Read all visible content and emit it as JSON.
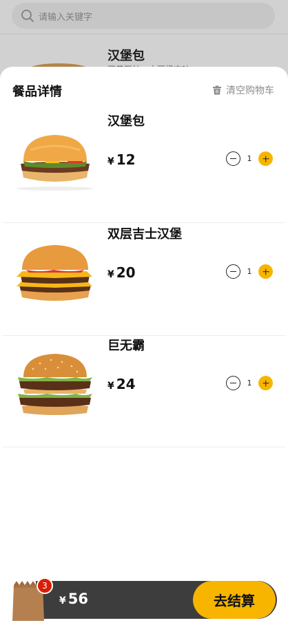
{
  "search": {
    "placeholder": "请输入关键字"
  },
  "background_item": {
    "title": "汉堡包",
    "description": "不曾瓦杜，土豆橙杏吐…"
  },
  "sheet": {
    "title": "餐品详情",
    "clear_cart_label": "清空购物车",
    "currency_symbol": "¥",
    "items": [
      {
        "name": "汉堡包",
        "price": "12",
        "quantity": "1"
      },
      {
        "name": "双层吉士汉堡",
        "price": "20",
        "quantity": "1"
      },
      {
        "name": "巨无霸",
        "price": "24",
        "quantity": "1"
      }
    ]
  },
  "cart": {
    "badge_count": "3",
    "currency_symbol": "¥",
    "total": "56",
    "checkout_label": "去结算"
  },
  "colors": {
    "accent": "#f7b500",
    "bar": "#3d3d3d",
    "badge": "#d81e06"
  }
}
